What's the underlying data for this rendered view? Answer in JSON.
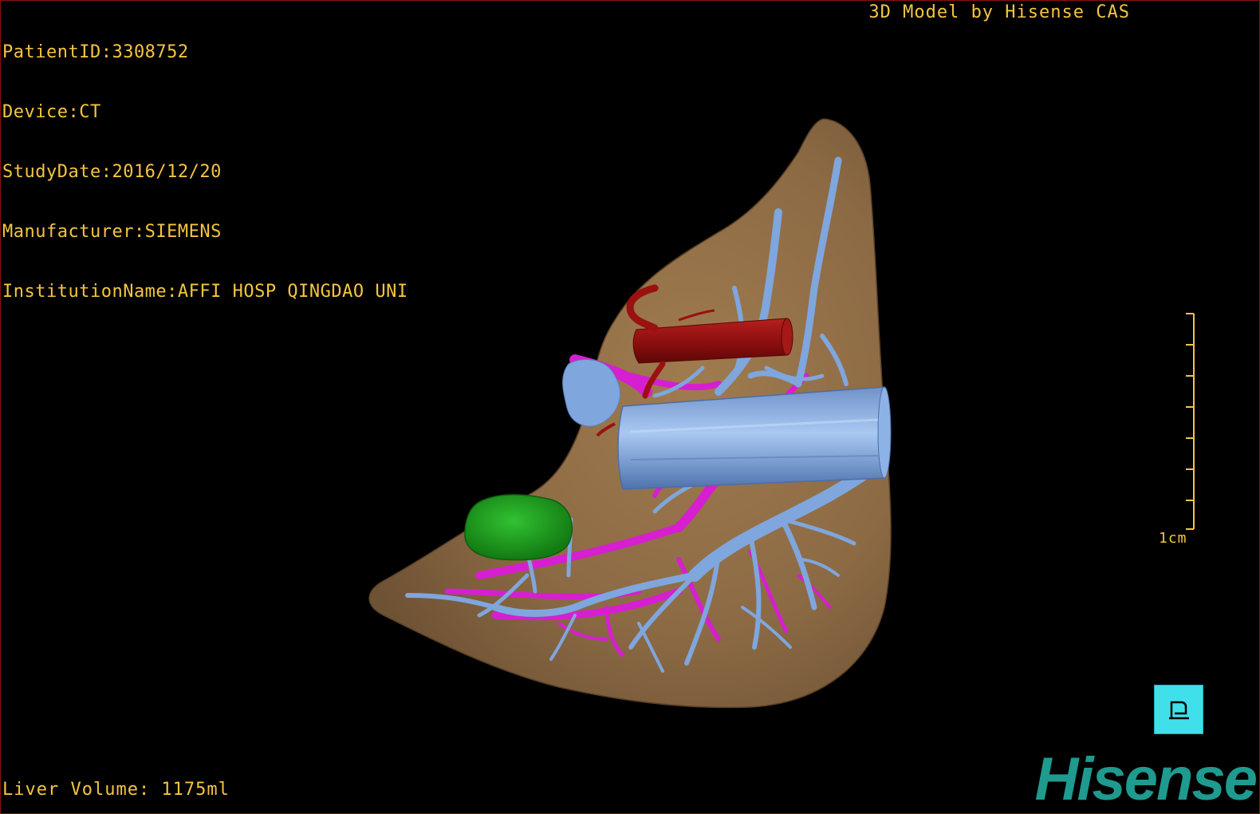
{
  "study_info": {
    "patient_id": "PatientID:3308752",
    "device": "Device:CT",
    "study_date": "StudyDate:2016/12/20",
    "manufacturer": "Manufacturer:SIEMENS",
    "institution": "InstitutionName:AFFI HOSP QINGDAO UNI"
  },
  "credit": "3D Model by Hisense CAS",
  "liver_volume": "Liver Volume: 1175ml",
  "scale_bar": {
    "label": "1cm",
    "tick_count": 8
  },
  "orientation_marker": {
    "icon": "patient-orientation-icon"
  },
  "brand_logo": "Hisense",
  "colors": {
    "overlay_text": "#f5c542",
    "liver": "#8c6a44",
    "hepatic_vein": "#7fa6dd",
    "portal_vein": "#d61fd0",
    "artery": "#9b1010",
    "lesion": "#1f9b1f",
    "orientation_button": "#3fe0ea",
    "logo": "#1f9a8f"
  }
}
